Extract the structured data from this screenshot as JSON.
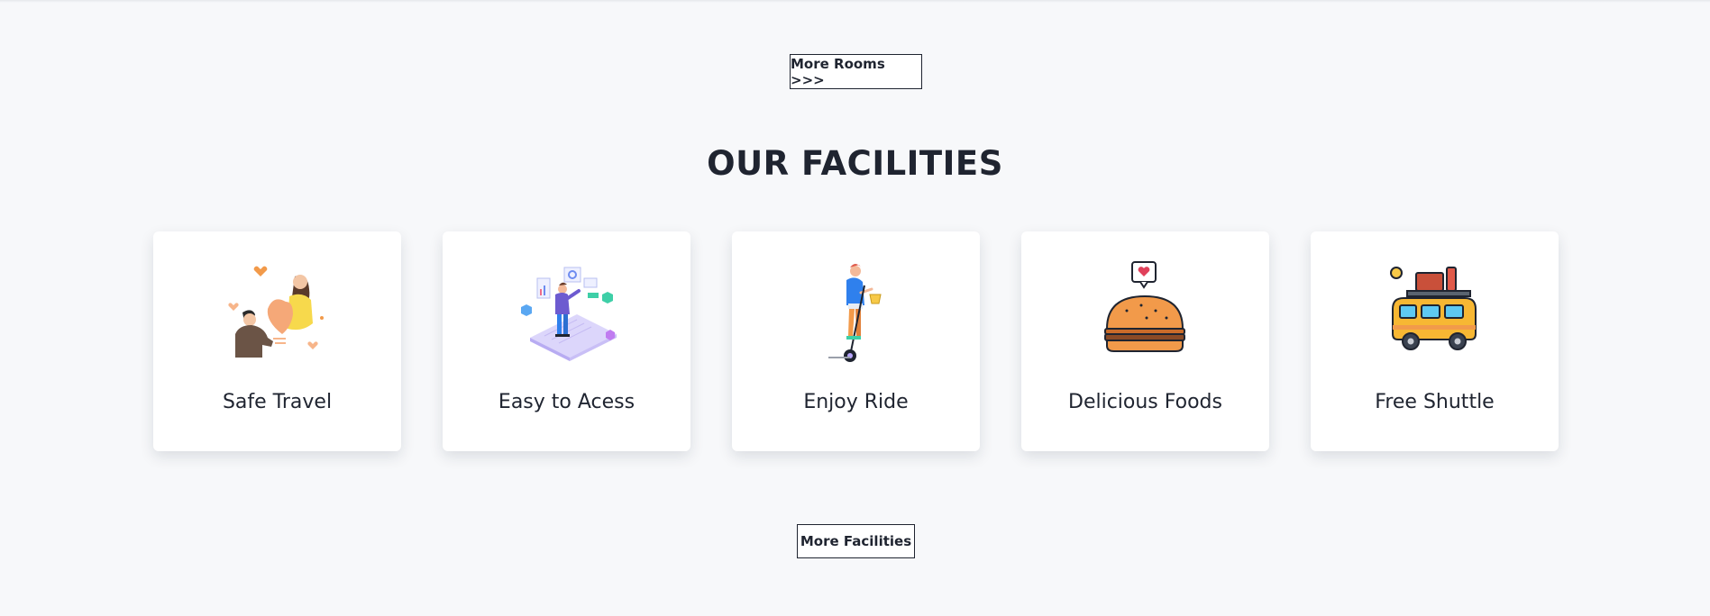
{
  "buttons": {
    "more_rooms": "More Rooms >>>",
    "more_facilities": "More Facilities"
  },
  "section": {
    "title": "OUR FACILITIES"
  },
  "facilities": [
    {
      "label": "Safe Travel",
      "icon": "safe-travel-illustration"
    },
    {
      "label": "Easy to Acess",
      "icon": "easy-access-illustration"
    },
    {
      "label": "Enjoy Ride",
      "icon": "enjoy-ride-illustration"
    },
    {
      "label": "Delicious Foods",
      "icon": "burger-icon"
    },
    {
      "label": "Free Shuttle",
      "icon": "shuttle-van-icon"
    }
  ],
  "colors": {
    "background": "#f7f8fa",
    "card": "#ffffff",
    "text": "#1f2430",
    "accent_orange": "#f29a4a",
    "accent_yellow": "#f7c948",
    "accent_purple": "#6d5bd0",
    "accent_blue": "#2f80ed"
  }
}
